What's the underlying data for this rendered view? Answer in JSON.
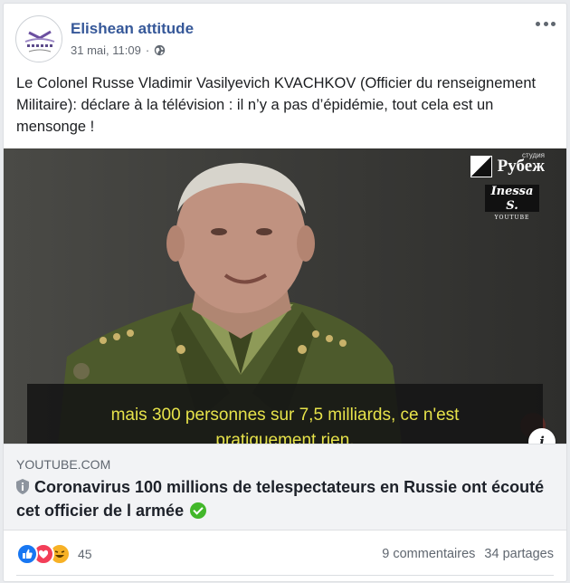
{
  "post": {
    "page_name": "Elishean attitude",
    "timestamp": "31 mai, 11:09",
    "separator": "·",
    "text": "Le Colonel Russe Vladimir Vasilyevich KVACHKOV (Officier du renseignement Militaire): déclare à la télévision : il n’y a pas d’épidémie, tout cela est un mensonge !"
  },
  "video": {
    "subtitle_line1": "mais 300 personnes sur 7,5 milliards, ce n'est",
    "subtitle_line2": "pratiquement rien.",
    "logo_small": "студия",
    "logo_big": "Рубеж",
    "logo2_name": "Inessa S.",
    "logo2_sub": "YOUTUBE",
    "info_label": "i"
  },
  "link": {
    "domain": "YOUTUBE.COM",
    "title": "Coronavirus 100 millions de telespectateurs en Russie ont écouté cet officier de l armée"
  },
  "footer": {
    "reactions_count": "45",
    "comments": "9 commentaires",
    "shares": "34 partages"
  },
  "colors": {
    "link_blue": "#365899",
    "like": "#1877f2",
    "love": "#f33e58",
    "haha": "#f7b125"
  }
}
